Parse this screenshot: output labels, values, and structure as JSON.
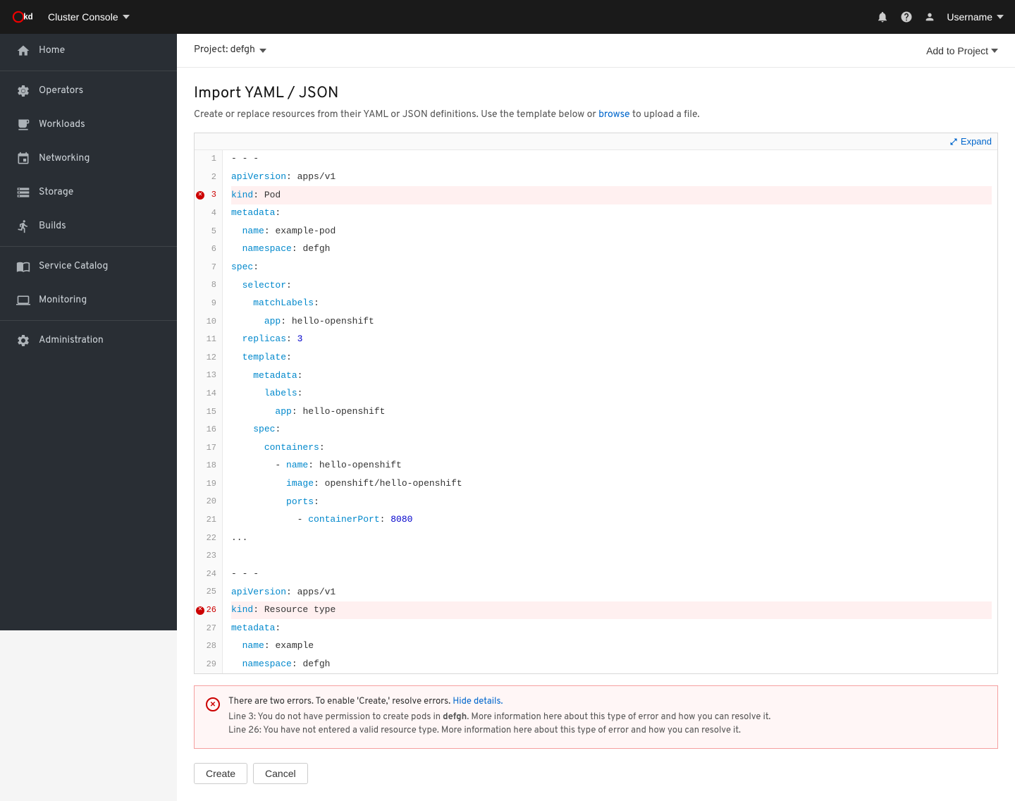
{
  "topnav": {
    "logo_alt": "OKD",
    "cluster_console_label": "Cluster Console",
    "user_label": "Username"
  },
  "subheader": {
    "project_label": "Project: defgh",
    "add_to_project_label": "Add to Project"
  },
  "page": {
    "title": "Import YAML / JSON",
    "description_prefix": "Create or replace resources from their YAML or JSON definitions. Use the template below or",
    "browse_link": "browse",
    "description_suffix": "to upload a file.",
    "expand_label": "Expand"
  },
  "sidebar": {
    "items": [
      {
        "id": "home",
        "label": "Home",
        "icon": "home"
      },
      {
        "id": "operators",
        "label": "Operators",
        "icon": "operators"
      },
      {
        "id": "workloads",
        "label": "Workloads",
        "icon": "workloads"
      },
      {
        "id": "networking",
        "label": "Networking",
        "icon": "networking"
      },
      {
        "id": "storage",
        "label": "Storage",
        "icon": "storage"
      },
      {
        "id": "builds",
        "label": "Builds",
        "icon": "builds"
      },
      {
        "id": "service-catalog",
        "label": "Service Catalog",
        "icon": "catalog"
      },
      {
        "id": "monitoring",
        "label": "Monitoring",
        "icon": "monitoring"
      },
      {
        "id": "administration",
        "label": "Administration",
        "icon": "administration"
      }
    ]
  },
  "code": {
    "lines": [
      {
        "num": 1,
        "content": "- - -",
        "error": false
      },
      {
        "num": 2,
        "content": "apiVersion: apps/v1",
        "error": false
      },
      {
        "num": 3,
        "content": "kind: Pod",
        "error": true
      },
      {
        "num": 4,
        "content": "metadata:",
        "error": false
      },
      {
        "num": 5,
        "content": "  name: example-pod",
        "error": false
      },
      {
        "num": 6,
        "content": "  namespace: defgh",
        "error": false
      },
      {
        "num": 7,
        "content": "spec:",
        "error": false
      },
      {
        "num": 8,
        "content": "  selector:",
        "error": false
      },
      {
        "num": 9,
        "content": "    matchLabels:",
        "error": false
      },
      {
        "num": 10,
        "content": "      app: hello-openshift",
        "error": false
      },
      {
        "num": 11,
        "content": "  replicas: 3",
        "error": false
      },
      {
        "num": 12,
        "content": "  template:",
        "error": false
      },
      {
        "num": 13,
        "content": "    metadata:",
        "error": false
      },
      {
        "num": 14,
        "content": "      labels:",
        "error": false
      },
      {
        "num": 15,
        "content": "        app: hello-openshift",
        "error": false
      },
      {
        "num": 16,
        "content": "    spec:",
        "error": false
      },
      {
        "num": 17,
        "content": "      containers:",
        "error": false
      },
      {
        "num": 18,
        "content": "        - name: hello-openshift",
        "error": false
      },
      {
        "num": 19,
        "content": "          image: openshift/hello-openshift",
        "error": false
      },
      {
        "num": 20,
        "content": "          ports:",
        "error": false
      },
      {
        "num": 21,
        "content": "            - containerPort: 8080",
        "error": false
      },
      {
        "num": 22,
        "content": "...",
        "error": false
      },
      {
        "num": 23,
        "content": "",
        "error": false
      },
      {
        "num": 24,
        "content": "- - -",
        "error": false
      },
      {
        "num": 25,
        "content": "apiVersion: apps/v1",
        "error": false
      },
      {
        "num": 26,
        "content": "kind: Resource type",
        "error": true
      },
      {
        "num": 27,
        "content": "metadata:",
        "error": false
      },
      {
        "num": 28,
        "content": "  name: example",
        "error": false
      },
      {
        "num": 29,
        "content": "  namespace: defgh",
        "error": false
      }
    ]
  },
  "errors": {
    "main_message": "There are two errors. To enable 'Create,' resolve errors.",
    "hide_details_label": "Hide details.",
    "error1_prefix": "Line 3: You do not have permission to create pods in ",
    "error1_bold": "defgh",
    "error1_suffix": ". More information here about this type of error and how you can resolve it.",
    "error2": "Line 26: You have not entered a valid resource type. More information here about this type of error and how you can resolve it."
  },
  "actions": {
    "create_label": "Create",
    "cancel_label": "Cancel"
  }
}
